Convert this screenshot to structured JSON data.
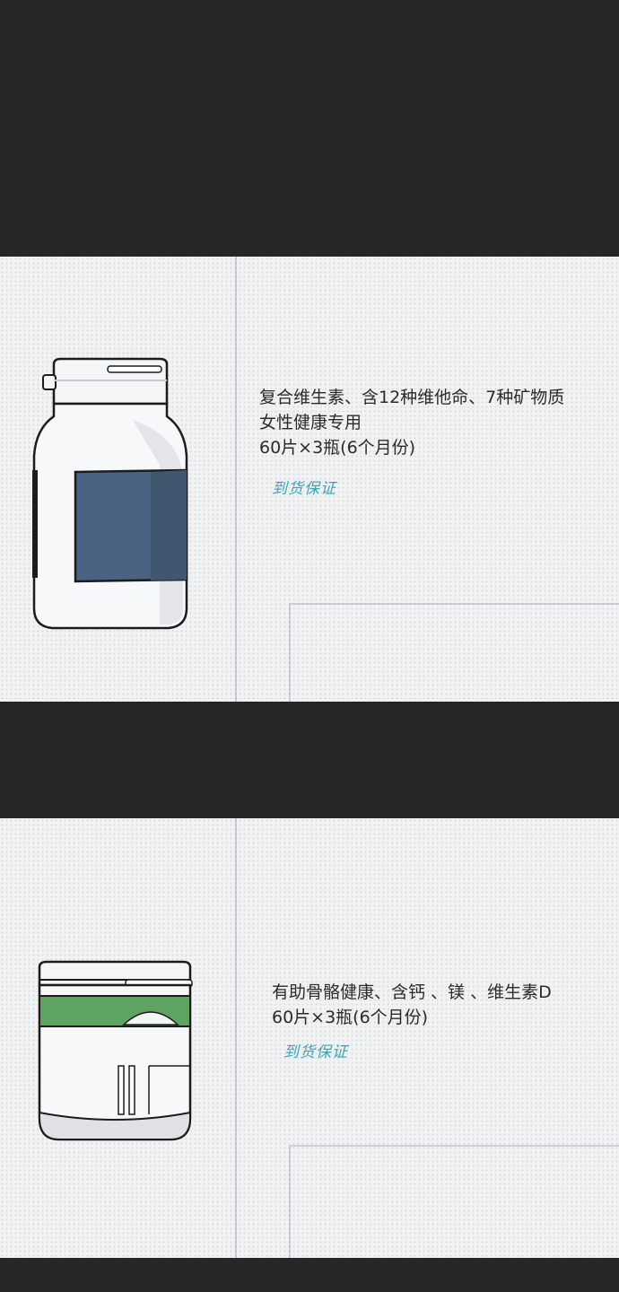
{
  "panels": [
    {
      "lines": [
        "复合维生素、含12种维他命、7种矿物质",
        "女性健康专用",
        "60片×3瓶(6个月份)"
      ],
      "stamp": "到货保证",
      "label_color": "#4b6382"
    },
    {
      "lines": [
        "有助骨骼健康、含钙 、镁 、维生素D",
        "60片×3瓶(6个月份)"
      ],
      "stamp": "到货保证",
      "band_color": "#5ea35f"
    }
  ]
}
